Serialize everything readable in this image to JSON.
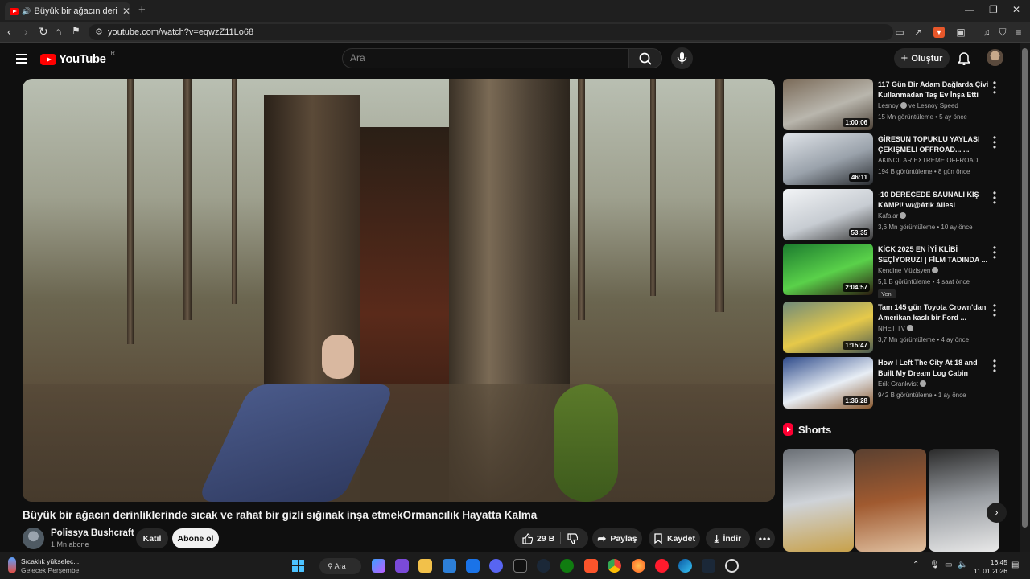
{
  "browser": {
    "tab_title": "Büyük bir ağacın derinliklerin",
    "url": "youtube.com/watch?v=eqwzZ11Lo68"
  },
  "header": {
    "logo_text": "YouTube",
    "country": "TR",
    "search_placeholder": "Ara",
    "create_label": "Oluştur"
  },
  "video": {
    "title": "Büyük bir ağacın derinliklerinde sıcak ve rahat bir gizli sığınak inşa etmekOrmancılık Hayatta Kalma",
    "channel": "Polissya Bushcraft",
    "subscribers": "1 Mn abone",
    "join_label": "Katıl",
    "subscribe_label": "Abone ol",
    "likes": "29 B",
    "share_label": "Paylaş",
    "save_label": "Kaydet",
    "download_label": "İndir"
  },
  "recommendations": [
    {
      "title": "117 Gün Bir Adam Dağlarda Çivi Kullanmadan Taş Ev İnşa Etti",
      "channel": "Lesnoy",
      "channel_extra": "ve Lesnoy Speed",
      "meta": "15 Mn görüntüleme • 5 ay önce",
      "duration": "1:00:06",
      "verified": true,
      "thumb_colors": [
        "#7a6a58",
        "#b9b6ad",
        "#4d4237"
      ]
    },
    {
      "title": "GİRESUN TOPUKLU YAYLASI ÇEKİŞMELİ OFFROAD... ...",
      "channel": "AKINCILAR EXTREME OFFROAD",
      "meta": "194 B görüntüleme • 8 gün önce",
      "duration": "46:11",
      "verified": false,
      "thumb_colors": [
        "#dfe3e8",
        "#9aa2ab",
        "#2a2d31"
      ]
    },
    {
      "title": "-10 DERECEDE SAUNALI KIŞ KAMPI! w/@Atik Ailesi",
      "channel": "Kafalar",
      "meta": "3,6 Mn görüntüleme • 10 ay önce",
      "duration": "53:35",
      "verified": true,
      "thumb_colors": [
        "#f2f4f6",
        "#c7ccd2",
        "#3b3b3b"
      ]
    },
    {
      "title": "KİCK 2025 EN İYİ KLİBİ SEÇİYORUZ! | FİLM TADINDA ...",
      "channel": "Kendine Müzisyen",
      "meta": "5,1 B görüntüleme • 4 saat önce",
      "duration": "2:04:57",
      "verified": true,
      "badge": "Yeni",
      "thumb_colors": [
        "#1b7a2e",
        "#5ad14a",
        "#2b1a10"
      ]
    },
    {
      "title": "Tam 145 gün Toyota Crown'dan Amerikan kaslı bir Ford ...",
      "channel": "NHET TV",
      "meta": "3,7 Mn görüntüleme • 4 ay önce",
      "duration": "1:15:47",
      "verified": true,
      "thumb_colors": [
        "#6f8a7a",
        "#e6c94a",
        "#4a5a52"
      ]
    },
    {
      "title": "How I Left The City At 18 and Built My Dream Log Cabin",
      "channel": "Erik Grankvist",
      "meta": "942 B görüntüleme • 1 ay önce",
      "duration": "1:36:28",
      "verified": true,
      "thumb_colors": [
        "#2d4a8a",
        "#e8eef5",
        "#8a5a30"
      ]
    }
  ],
  "shorts": {
    "label": "Shorts",
    "items": [
      {
        "colors": [
          "#6a6f75",
          "#cfd3d8",
          "#c8a14a"
        ]
      },
      {
        "colors": [
          "#5a4030",
          "#a05a30",
          "#e0c0a0"
        ]
      },
      {
        "colors": [
          "#2a2a2a",
          "#9a9ea3",
          "#e8e8e8"
        ]
      }
    ]
  },
  "taskbar": {
    "weather_title": "Sıcaklık yükselec...",
    "weather_sub": "Gelecek Perşembe",
    "search_label": "Ara",
    "time": "16:45",
    "date": "11.01.2026"
  }
}
